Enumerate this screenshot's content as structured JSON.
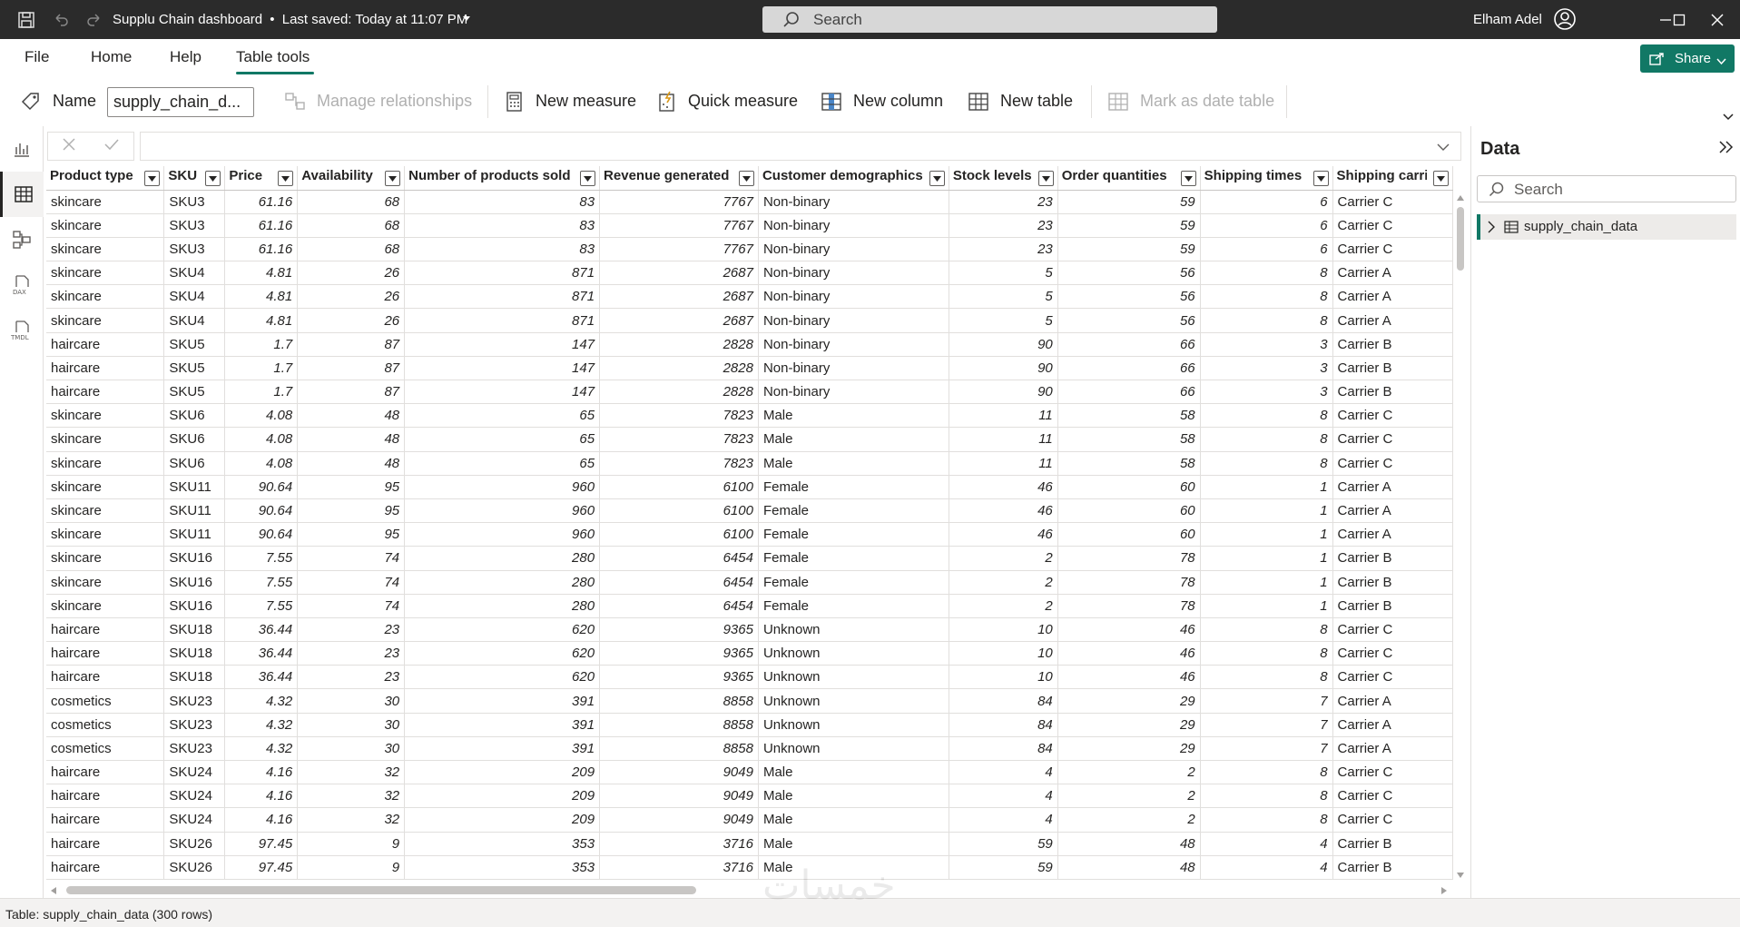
{
  "window": {
    "title": "Supplu Chain dashboard",
    "saved_status": "Last saved: Today at 11:07 PM",
    "search_placeholder": "Search",
    "user_name": "Elham Adel"
  },
  "menu": {
    "items": [
      "File",
      "Home",
      "Help",
      "Table tools"
    ],
    "active": "Table tools",
    "share_label": "Share"
  },
  "ribbon": {
    "name_label": "Name",
    "name_value": "supply_chain_d...",
    "manage_relationships": "Manage relationships",
    "new_measure": "New measure",
    "quick_measure": "Quick measure",
    "new_column": "New column",
    "new_table": "New table",
    "mark_as_date_table": "Mark as date table"
  },
  "table": {
    "columns": [
      "Product type",
      "SKU",
      "Price",
      "Availability",
      "Number of products sold",
      "Revenue generated",
      "Customer demographics",
      "Stock levels",
      "Order quantities",
      "Shipping times",
      "Shipping carriers"
    ],
    "rows": [
      [
        "skincare",
        "SKU3",
        "61.16",
        "68",
        "83",
        "7767",
        "Non-binary",
        "23",
        "59",
        "6",
        "Carrier C"
      ],
      [
        "skincare",
        "SKU3",
        "61.16",
        "68",
        "83",
        "7767",
        "Non-binary",
        "23",
        "59",
        "6",
        "Carrier C"
      ],
      [
        "skincare",
        "SKU3",
        "61.16",
        "68",
        "83",
        "7767",
        "Non-binary",
        "23",
        "59",
        "6",
        "Carrier C"
      ],
      [
        "skincare",
        "SKU4",
        "4.81",
        "26",
        "871",
        "2687",
        "Non-binary",
        "5",
        "56",
        "8",
        "Carrier A"
      ],
      [
        "skincare",
        "SKU4",
        "4.81",
        "26",
        "871",
        "2687",
        "Non-binary",
        "5",
        "56",
        "8",
        "Carrier A"
      ],
      [
        "skincare",
        "SKU4",
        "4.81",
        "26",
        "871",
        "2687",
        "Non-binary",
        "5",
        "56",
        "8",
        "Carrier A"
      ],
      [
        "haircare",
        "SKU5",
        "1.7",
        "87",
        "147",
        "2828",
        "Non-binary",
        "90",
        "66",
        "3",
        "Carrier B"
      ],
      [
        "haircare",
        "SKU5",
        "1.7",
        "87",
        "147",
        "2828",
        "Non-binary",
        "90",
        "66",
        "3",
        "Carrier B"
      ],
      [
        "haircare",
        "SKU5",
        "1.7",
        "87",
        "147",
        "2828",
        "Non-binary",
        "90",
        "66",
        "3",
        "Carrier B"
      ],
      [
        "skincare",
        "SKU6",
        "4.08",
        "48",
        "65",
        "7823",
        "Male",
        "11",
        "58",
        "8",
        "Carrier C"
      ],
      [
        "skincare",
        "SKU6",
        "4.08",
        "48",
        "65",
        "7823",
        "Male",
        "11",
        "58",
        "8",
        "Carrier C"
      ],
      [
        "skincare",
        "SKU6",
        "4.08",
        "48",
        "65",
        "7823",
        "Male",
        "11",
        "58",
        "8",
        "Carrier C"
      ],
      [
        "skincare",
        "SKU11",
        "90.64",
        "95",
        "960",
        "6100",
        "Female",
        "46",
        "60",
        "1",
        "Carrier A"
      ],
      [
        "skincare",
        "SKU11",
        "90.64",
        "95",
        "960",
        "6100",
        "Female",
        "46",
        "60",
        "1",
        "Carrier A"
      ],
      [
        "skincare",
        "SKU11",
        "90.64",
        "95",
        "960",
        "6100",
        "Female",
        "46",
        "60",
        "1",
        "Carrier A"
      ],
      [
        "skincare",
        "SKU16",
        "7.55",
        "74",
        "280",
        "6454",
        "Female",
        "2",
        "78",
        "1",
        "Carrier B"
      ],
      [
        "skincare",
        "SKU16",
        "7.55",
        "74",
        "280",
        "6454",
        "Female",
        "2",
        "78",
        "1",
        "Carrier B"
      ],
      [
        "skincare",
        "SKU16",
        "7.55",
        "74",
        "280",
        "6454",
        "Female",
        "2",
        "78",
        "1",
        "Carrier B"
      ],
      [
        "haircare",
        "SKU18",
        "36.44",
        "23",
        "620",
        "9365",
        "Unknown",
        "10",
        "46",
        "8",
        "Carrier C"
      ],
      [
        "haircare",
        "SKU18",
        "36.44",
        "23",
        "620",
        "9365",
        "Unknown",
        "10",
        "46",
        "8",
        "Carrier C"
      ],
      [
        "haircare",
        "SKU18",
        "36.44",
        "23",
        "620",
        "9365",
        "Unknown",
        "10",
        "46",
        "8",
        "Carrier C"
      ],
      [
        "cosmetics",
        "SKU23",
        "4.32",
        "30",
        "391",
        "8858",
        "Unknown",
        "84",
        "29",
        "7",
        "Carrier A"
      ],
      [
        "cosmetics",
        "SKU23",
        "4.32",
        "30",
        "391",
        "8858",
        "Unknown",
        "84",
        "29",
        "7",
        "Carrier A"
      ],
      [
        "cosmetics",
        "SKU23",
        "4.32",
        "30",
        "391",
        "8858",
        "Unknown",
        "84",
        "29",
        "7",
        "Carrier A"
      ],
      [
        "haircare",
        "SKU24",
        "4.16",
        "32",
        "209",
        "9049",
        "Male",
        "4",
        "2",
        "8",
        "Carrier C"
      ],
      [
        "haircare",
        "SKU24",
        "4.16",
        "32",
        "209",
        "9049",
        "Male",
        "4",
        "2",
        "8",
        "Carrier C"
      ],
      [
        "haircare",
        "SKU24",
        "4.16",
        "32",
        "209",
        "9049",
        "Male",
        "4",
        "2",
        "8",
        "Carrier C"
      ],
      [
        "haircare",
        "SKU26",
        "97.45",
        "9",
        "353",
        "3716",
        "Male",
        "59",
        "48",
        "4",
        "Carrier B"
      ],
      [
        "haircare",
        "SKU26",
        "97.45",
        "9",
        "353",
        "3716",
        "Male",
        "59",
        "48",
        "4",
        "Carrier B"
      ]
    ]
  },
  "data_pane": {
    "title": "Data",
    "search_placeholder": "Search",
    "tables": [
      "supply_chain_data"
    ]
  },
  "status_bar": {
    "text": "Table: supply_chain_data (300 rows)"
  },
  "watermark": "خمسات",
  "colors": {
    "titlebar_bg": "#2b2b2b",
    "accent": "#117865",
    "grid_line": "#e1dfdd"
  }
}
